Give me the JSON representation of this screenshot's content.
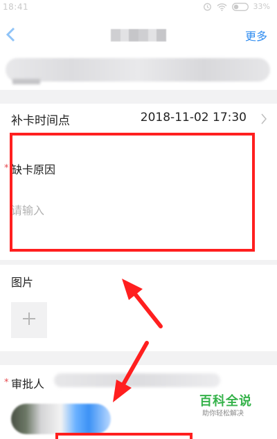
{
  "status_bar": {
    "time": "18:41",
    "battery": "33%",
    "icons": [
      "alarm-icon",
      "wifi-icon",
      "toggle-icon",
      "battery-icon"
    ]
  },
  "header": {
    "more_label": "更多",
    "accent_color": "#2f8cf0"
  },
  "form": {
    "supplement_time_label": "补卡时间点",
    "supplement_time_value": "2018-11-02 17:30",
    "reason_label": "缺卡原因",
    "reason_placeholder": "请输入",
    "reason_value": "",
    "image_label": "图片",
    "approver_label": "审批人",
    "required_marker": "*"
  },
  "watermark": {
    "main": "百科全说",
    "sub": "助你轻松解决"
  },
  "colors": {
    "annotation_red": "#ff1f1f",
    "required_star": "#e5484d",
    "watermark_green": "#35b24a"
  }
}
